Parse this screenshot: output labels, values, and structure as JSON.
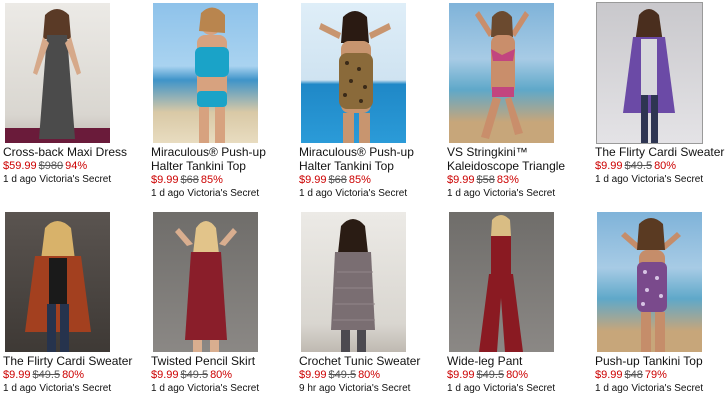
{
  "products": [
    {
      "title": "Cross-back Maxi Dress",
      "price": "$59.99",
      "old": "$980",
      "pct": "94%",
      "age": "1 d ago",
      "store": "Victoria's Secret",
      "image": "model-in-grey-maxi-dress"
    },
    {
      "title_lines": [
        "Miraculous® Push-up",
        "Halter Tankini Top"
      ],
      "price": "$9.99",
      "old": "$68",
      "pct": "85%",
      "age": "1 d ago",
      "store": "Victoria's Secret",
      "image": "model-in-blue-tankini"
    },
    {
      "title_lines": [
        "Miraculous® Push-up",
        "Halter Tankini Top"
      ],
      "price": "$9.99",
      "old": "$68",
      "pct": "85%",
      "age": "1 d ago",
      "store": "Victoria's Secret",
      "image": "model-in-leopard-tankini"
    },
    {
      "title_lines": [
        "VS Stringkini™",
        "Kaleidoscope Triangle"
      ],
      "price": "$9.99",
      "old": "$58",
      "pct": "83%",
      "age": "1 d ago",
      "store": "Victoria's Secret",
      "image": "model-in-pink-bikini"
    },
    {
      "title": "The Flirty Cardi Sweater",
      "price": "$9.99",
      "old": "$49.5",
      "pct": "80%",
      "age": "1 d ago",
      "store": "Victoria's Secret",
      "image": "model-in-purple-cardigan"
    },
    {
      "title": "The Flirty Cardi Sweater",
      "price": "$9.99",
      "old": "$49.5",
      "pct": "80%",
      "age": "1 d ago",
      "store": "Victoria's Secret",
      "image": "model-in-rust-cardigan"
    },
    {
      "title": "Twisted Pencil Skirt",
      "price": "$9.99",
      "old": "$49.5",
      "pct": "80%",
      "age": "1 d ago",
      "store": "Victoria's Secret",
      "image": "model-in-red-dress"
    },
    {
      "title": "Crochet Tunic Sweater",
      "price": "$9.99",
      "old": "$49.5",
      "pct": "80%",
      "age": "9 hr ago",
      "store": "Victoria's Secret",
      "image": "model-in-grey-tunic"
    },
    {
      "title": "Wide-leg Pant",
      "price": "$9.99",
      "old": "$49.5",
      "pct": "80%",
      "age": "1 d ago",
      "store": "Victoria's Secret",
      "image": "model-in-red-jumpsuit"
    },
    {
      "title": "Push-up Tankini Top",
      "price": "$9.99",
      "old": "$48",
      "pct": "79%",
      "age": "1 d ago",
      "store": "Victoria's Secret",
      "image": "model-in-purple-tankini"
    }
  ],
  "colors": {
    "price": "#cc0000",
    "old_price": "#555555",
    "text": "#111111"
  }
}
